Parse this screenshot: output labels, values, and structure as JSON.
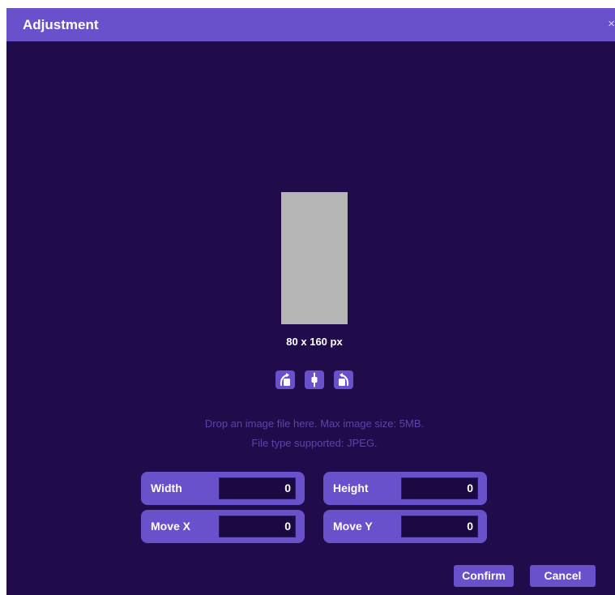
{
  "dialog": {
    "title": "Adjustment",
    "close_glyph": "×"
  },
  "preview": {
    "size_label": "80 x 160 px"
  },
  "tools": [
    {
      "name": "rotate-left-icon"
    },
    {
      "name": "flip-icon"
    },
    {
      "name": "rotate-right-icon"
    }
  ],
  "drop_zone": {
    "line1": "Drop an image file here. Max image size: 5MB.",
    "line2": "File type supported: JPEG."
  },
  "fields": {
    "width": {
      "label": "Width",
      "value": "0"
    },
    "height": {
      "label": "Height",
      "value": "0"
    },
    "move_x": {
      "label": "Move X",
      "value": "0"
    },
    "move_y": {
      "label": "Move Y",
      "value": "0"
    }
  },
  "buttons": {
    "confirm": "Confirm",
    "cancel": "Cancel"
  },
  "colors": {
    "accent": "#6a51cc",
    "background": "#200c4a",
    "hint_text": "#5a45a8",
    "preview_placeholder": "#b5b5b5"
  }
}
